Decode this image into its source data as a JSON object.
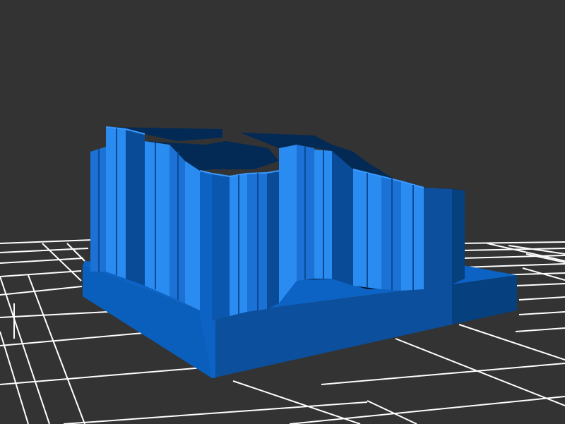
{
  "viewport": {
    "background_color": "#333333",
    "grid_color": "#ffffff"
  },
  "model": {
    "colors": {
      "base_front": "#0a5fbd",
      "base_front_dark": "#0c4f9c",
      "base_side": "#07407e",
      "base_top": "#0d63c4",
      "wall_light": "#2a8bf0",
      "wall_mid": "#1c71d4",
      "wall_dark": "#0a4b98",
      "wall_shadow": "#032a55",
      "cavity": "#01152b",
      "top_edge": "#3a9bff"
    }
  }
}
